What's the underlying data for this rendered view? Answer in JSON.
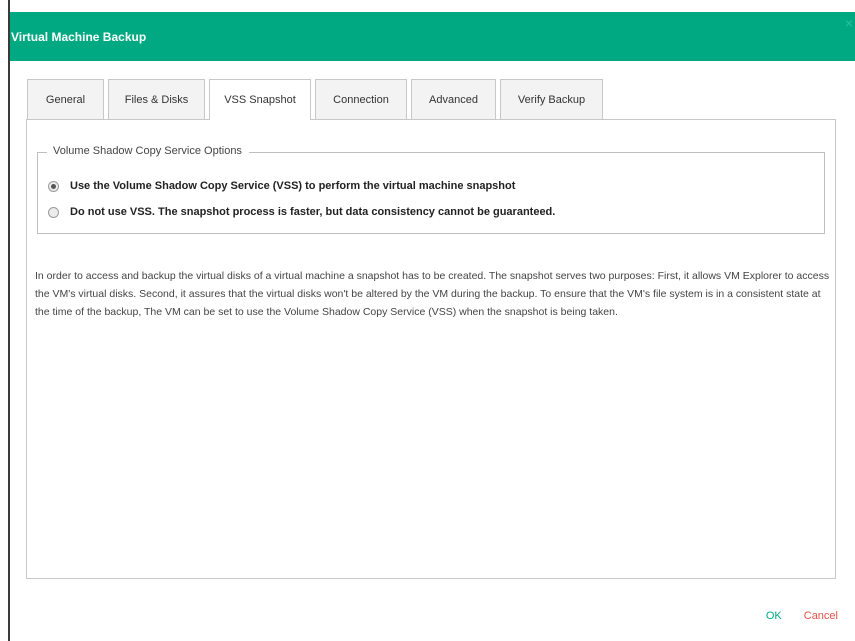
{
  "dialog": {
    "title": "Virtual Machine Backup",
    "close_glyph": "×"
  },
  "tabs": [
    {
      "label": "General",
      "active": false
    },
    {
      "label": "Files & Disks",
      "active": false
    },
    {
      "label": "VSS Snapshot",
      "active": true
    },
    {
      "label": "Connection",
      "active": false
    },
    {
      "label": "Advanced",
      "active": false
    },
    {
      "label": "Verify Backup",
      "active": false
    }
  ],
  "vss_options": {
    "legend": "Volume Shadow Copy Service Options",
    "options": [
      {
        "label": "Use the Volume Shadow Copy Service (VSS) to perform the virtual machine snapshot",
        "selected": true
      },
      {
        "label": "Do not use VSS. The snapshot process is faster, but data consistency cannot be guaranteed.",
        "selected": false
      }
    ]
  },
  "description": "In order to access and backup the virtual disks of a virtual machine a snapshot has to be created. The snapshot serves two purposes: First, it allows VM Explorer to access the VM's virtual disks. Second, it assures that the virtual disks won't be altered by the VM during the backup. To ensure that the VM's file system is in a consistent state at the time of the backup, The VM can be set to use the Volume Shadow Copy Service (VSS) when the snapshot is being taken.",
  "footer": {
    "ok_label": "OK",
    "cancel_label": "Cancel"
  },
  "colors": {
    "accent": "#01a982",
    "cancel": "#e0534a"
  }
}
